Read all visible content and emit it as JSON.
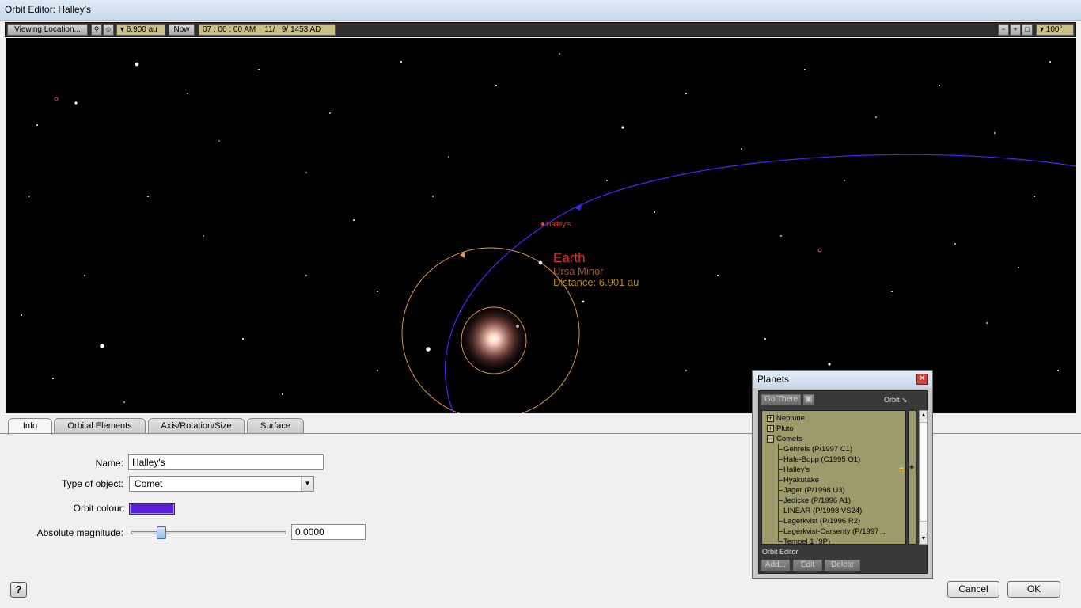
{
  "window": {
    "title": "Orbit Editor: Halley's"
  },
  "toolbar": {
    "viewing_location": "Viewing Location...",
    "distance": "▾ 6.900 au",
    "now": "Now",
    "datetime": "07 : 00 : 00 AM    11/   9/ 1453 AD",
    "fov": "▾ 100°"
  },
  "sky": {
    "comet_label": "Halley's",
    "object_name": "Earth",
    "constellation": "Ursa Minor",
    "distance": "Distance: 6.901 au"
  },
  "tabs": [
    "Info",
    "Orbital Elements",
    "Axis/Rotation/Size",
    "Surface"
  ],
  "form": {
    "name_label": "Name:",
    "name_value": "Halley's",
    "type_label": "Type of object:",
    "type_value": "Comet",
    "colour_label": "Orbit colour:",
    "colour_value": "#5a1fd6",
    "magnitude_label": "Absolute magnitude:",
    "magnitude_value": "0.0000",
    "magnitude_slider_fraction": 0.18
  },
  "buttons": {
    "help": "?",
    "cancel": "Cancel",
    "ok": "OK"
  },
  "planets_panel": {
    "title": "Planets",
    "go_there": "Go There",
    "orbit_label": "Orbit",
    "items": [
      {
        "label": "Neptune",
        "type": "group",
        "expanded": false
      },
      {
        "label": "Pluto",
        "type": "group",
        "expanded": false
      },
      {
        "label": "Comets",
        "type": "group",
        "expanded": true
      },
      {
        "label": "Gehrels (P/1997 C1)",
        "type": "item"
      },
      {
        "label": "Hale-Bopp (C1995 O1)",
        "type": "item"
      },
      {
        "label": "Halley's",
        "type": "item"
      },
      {
        "label": "Hyakutake",
        "type": "item"
      },
      {
        "label": "Jager (P/1998 U3)",
        "type": "item"
      },
      {
        "label": "Jedicke (P/1996 A1)",
        "type": "item"
      },
      {
        "label": "LINEAR (P/1998 VS24)",
        "type": "item"
      },
      {
        "label": "Lagerkvist (P/1996 R2)",
        "type": "item"
      },
      {
        "label": "Lagerkvist-Carsenty (P/1997 ...",
        "type": "item"
      },
      {
        "label": "Tempel 1 (9P)",
        "type": "item"
      }
    ],
    "section_label": "Orbit Editor",
    "add": "Add...",
    "edit": "Edit",
    "delete": "Delete"
  },
  "colors": {
    "orbit_comet": "#3a2cff",
    "orbit_planet": "#e0954a",
    "sky": "#000000",
    "panel_list": "#9d9a6c"
  }
}
